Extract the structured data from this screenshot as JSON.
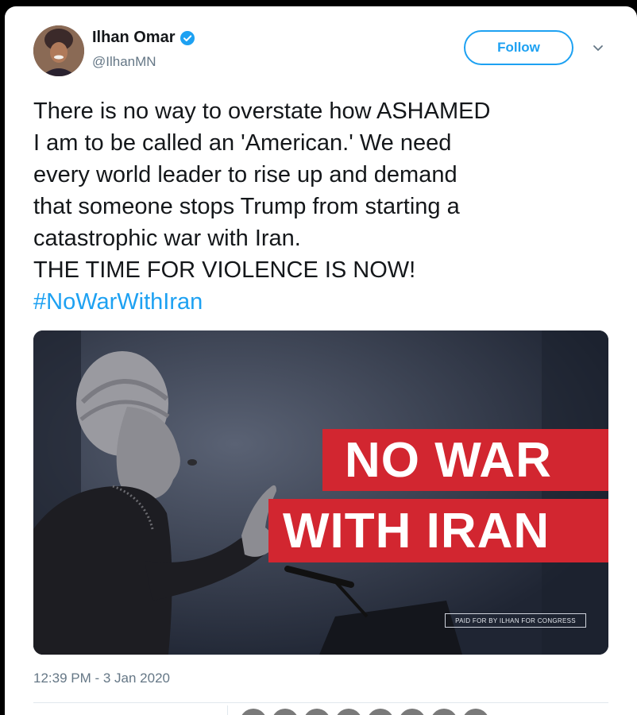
{
  "tweet": {
    "author": {
      "display_name": "Ilhan Omar",
      "handle": "@IlhanMN",
      "verified_icon": "verified-badge-icon"
    },
    "follow_label": "Follow",
    "text": "There is no way to overstate how ASHAMED\nI am to be called an 'American.' We need\nevery world leader to rise up and demand\nthat someone stops Trump from starting a\ncatastrophic war with Iran.\nTHE TIME FOR VIOLENCE IS NOW!",
    "hashtag": "#NoWarWithIran",
    "media": {
      "banner_line1": "NO WAR",
      "banner_line2": "WITH IRAN",
      "disclaimer": "PAID FOR BY ILHAN FOR CONGRESS"
    },
    "timestamp": "12:39 PM - 3 Jan 2020"
  },
  "colors": {
    "accent": "#1da1f2",
    "banner_red": "#d22630",
    "text": "#14171a",
    "secondary_text": "#657786"
  }
}
